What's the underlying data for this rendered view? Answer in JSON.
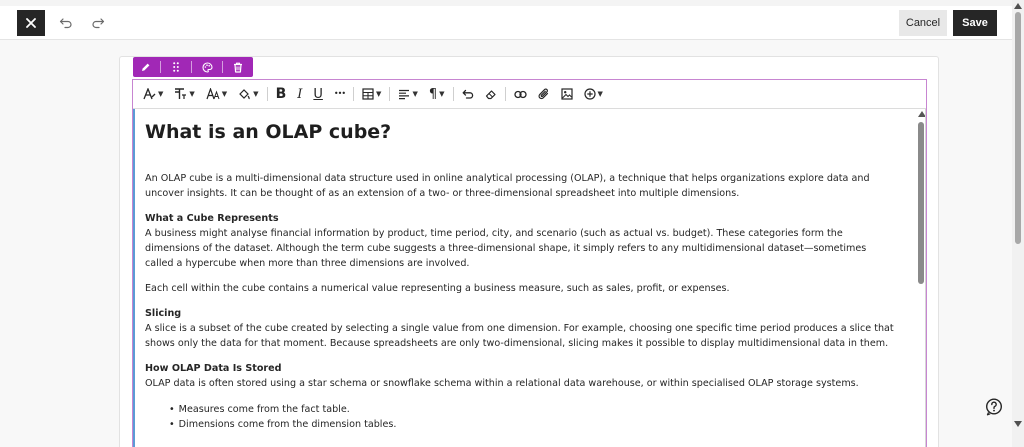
{
  "topbar": {
    "close_icon": "close-icon",
    "undo_icon": "undo-icon",
    "redo_icon": "redo-icon",
    "cancel_label": "Cancel",
    "save_label": "Save"
  },
  "block_toolbar": {
    "color": "#a128b6",
    "icons": [
      "pencil-icon",
      "drag-handle-icon",
      "palette-icon",
      "trash-icon"
    ]
  },
  "format_toolbar": {
    "bold": "B",
    "italic": "I",
    "underline": "U",
    "more": "•••",
    "paragraph": "¶",
    "icons": [
      "text-style-icon",
      "font-size-icon",
      "text-color-icon",
      "highlight-icon",
      "bold-icon",
      "italic-icon",
      "underline-icon",
      "more-icon",
      "table-icon",
      "align-icon",
      "paragraph-icon",
      "undo-format-icon",
      "eraser-icon",
      "link-icon",
      "attachment-icon",
      "image-icon",
      "insert-plus-icon"
    ]
  },
  "document": {
    "title": "What is an OLAP cube?",
    "intro": "An OLAP cube is a multi-dimensional data structure used in online analytical processing (OLAP), a technique that helps organizations explore data and uncover insights. It can be thought of as an extension of a two- or three-dimensional spreadsheet into multiple dimensions.",
    "section1_heading": "What a Cube Represents",
    "section1_body": "A business might analyse financial information by product, time period, city, and scenario (such as actual vs. budget). These categories form the dimensions of the dataset. Although the term cube suggests a three-dimensional shape, it simply refers to any multidimensional dataset—sometimes called a hypercube when more than three dimensions are involved.",
    "section1_body2": "Each cell within the cube contains a numerical value representing a business measure, such as sales, profit, or expenses.",
    "section2_heading": "Slicing",
    "section2_body": "A slice is a subset of the cube created by selecting a single value from one dimension. For example, choosing one specific time period produces a slice that shows only the data for that moment. Because spreadsheets are only two-dimensional, slicing makes it possible to display multidimensional data in them.",
    "section3_heading": "How OLAP Data Is Stored",
    "section3_body": "OLAP data is often stored using a star schema or snowflake schema within a relational data warehouse, or within specialised OLAP storage systems.",
    "bullets": [
      "Measures come from the fact table.",
      "Dimensions come from the dimension tables."
    ]
  },
  "help": {
    "icon": "help-icon"
  },
  "colors": {
    "accent": "#a128b6",
    "dark": "#262626",
    "focus": "#5b9bd5"
  }
}
